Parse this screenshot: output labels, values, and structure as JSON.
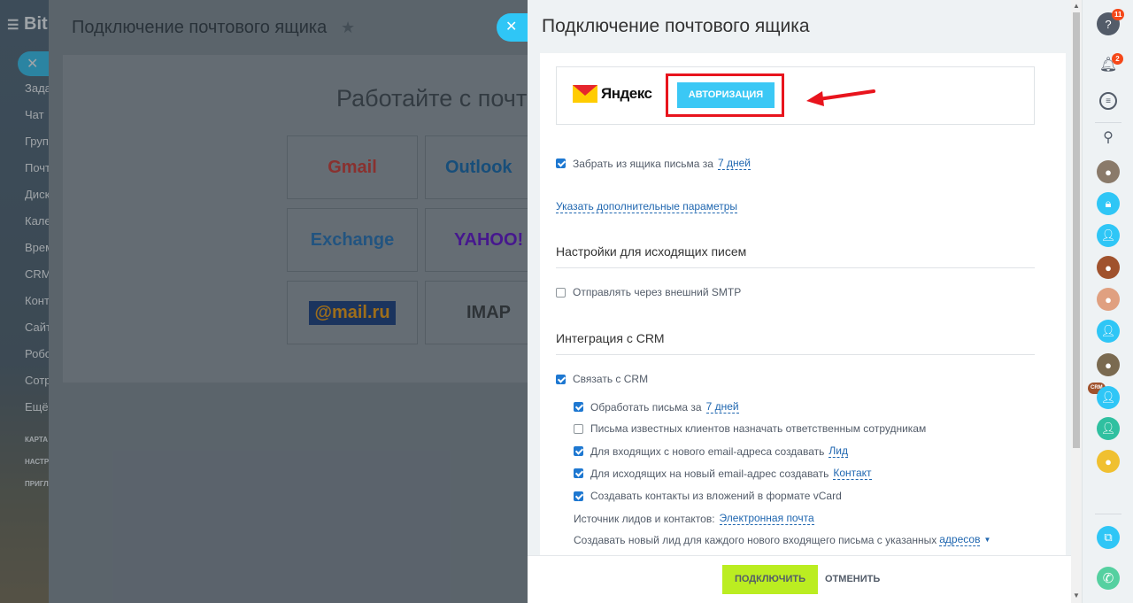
{
  "leftbar": {
    "logo": "Bitrix",
    "nav": [
      "Задачи",
      "Чат",
      "Группы",
      "Почта",
      "Диск",
      "Календарь",
      "Время",
      "CRM",
      "Контакт-центр",
      "Сайты",
      "Роботы",
      "Сотрудники",
      "Ещё"
    ],
    "small": [
      "КАРТА",
      "НАСТРОЙКИ",
      "ПРИГЛАСИТЬ"
    ]
  },
  "background_slider": {
    "title": "Подключение почтового ящика",
    "tagline": "Работайте с почтой",
    "tiles": [
      {
        "label": "Gmail",
        "color": "#d93025"
      },
      {
        "label": "Outlook",
        "color": "#0a64ad"
      },
      {
        "label": "Exchange",
        "color": "#1e6fb8"
      },
      {
        "label": "YAHOO!",
        "color": "#5f01d1"
      },
      {
        "label": "@mail.ru",
        "color": "#ff9e00"
      },
      {
        "label": "IMAP",
        "color": "#333333"
      }
    ]
  },
  "slider": {
    "title": "Подключение почтового ящика",
    "provider": {
      "name": "Яндекс",
      "auth_button": "АВТОРИЗАЦИЯ"
    },
    "fetch_mail": {
      "label": "Забрать из ящика письма за",
      "value": "7 дней",
      "checked": true
    },
    "extra_params_link": "Указать дополнительные параметры",
    "outgoing_section": {
      "title": "Настройки для исходящих писем",
      "smtp": {
        "label": "Отправлять через внешний SMTP",
        "checked": false
      }
    },
    "crm_section": {
      "title": "Интеграция с CRM",
      "link_crm": {
        "label": "Связать с CRM",
        "checked": true
      },
      "options": [
        {
          "label": "Обработать письма за",
          "link": "7 дней",
          "checked": true
        },
        {
          "label": "Письма известных клиентов назначать ответственным сотрудникам",
          "link": "",
          "checked": false
        },
        {
          "label": "Для входящих с нового email-адреса создавать",
          "link": "Лид",
          "checked": true
        },
        {
          "label": "Для исходящих на новый email-адрес создавать",
          "link": "Контакт",
          "checked": true
        },
        {
          "label": "Создавать контакты из вложений в формате vCard",
          "link": "",
          "checked": true
        }
      ],
      "source": {
        "label": "Источник лидов и контактов:",
        "value": "Электронная почта"
      },
      "new_lead": {
        "label": "Создавать новый лид для каждого нового входящего письма с указанных",
        "value": "адресов"
      }
    },
    "footer": {
      "connect": "ПОДКЛЮЧИТЬ",
      "cancel": "ОТМЕНИТЬ"
    }
  },
  "rightbar": {
    "help_badge": "11",
    "notify_badge": "2",
    "crm_tag": "CRM"
  }
}
